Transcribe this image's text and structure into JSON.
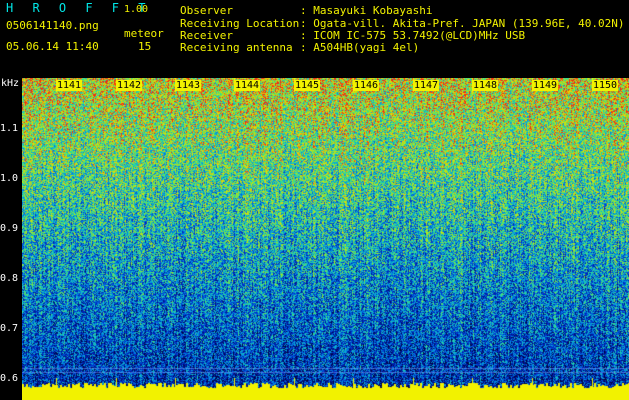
{
  "header": {
    "app_title": "H R O F F T",
    "version": "1.00",
    "filename": "0506141140.png",
    "mode": "meteor",
    "datetime": "05.06.14 11:40",
    "count": "15",
    "info": [
      {
        "label": "Observer",
        "value": ": Masayuki Kobayashi"
      },
      {
        "label": "Receiving Location",
        "value": ": Ogata-vill. Akita-Pref. JAPAN (139.96E, 40.02N)"
      },
      {
        "label": "Receiver",
        "value": ": ICOM IC-575 53.7492(@LCD)MHz USB"
      },
      {
        "label": "Receiving antenna",
        "value": ": A504HB(yagi 4el)"
      }
    ]
  },
  "axis": {
    "unit": "kHz",
    "ticks": [
      "1.1",
      "1.0",
      "0.9",
      "0.8",
      "0.7",
      "0.6"
    ]
  },
  "minutes": [
    "1141",
    "1142",
    "1143",
    "1144",
    "1145",
    "1146",
    "1147",
    "1148",
    "1149",
    "1150"
  ],
  "colors": {
    "header_text": "#f2f200",
    "accent": "#00e6e6",
    "baseline": "#f2f200",
    "background": "#000000"
  }
}
